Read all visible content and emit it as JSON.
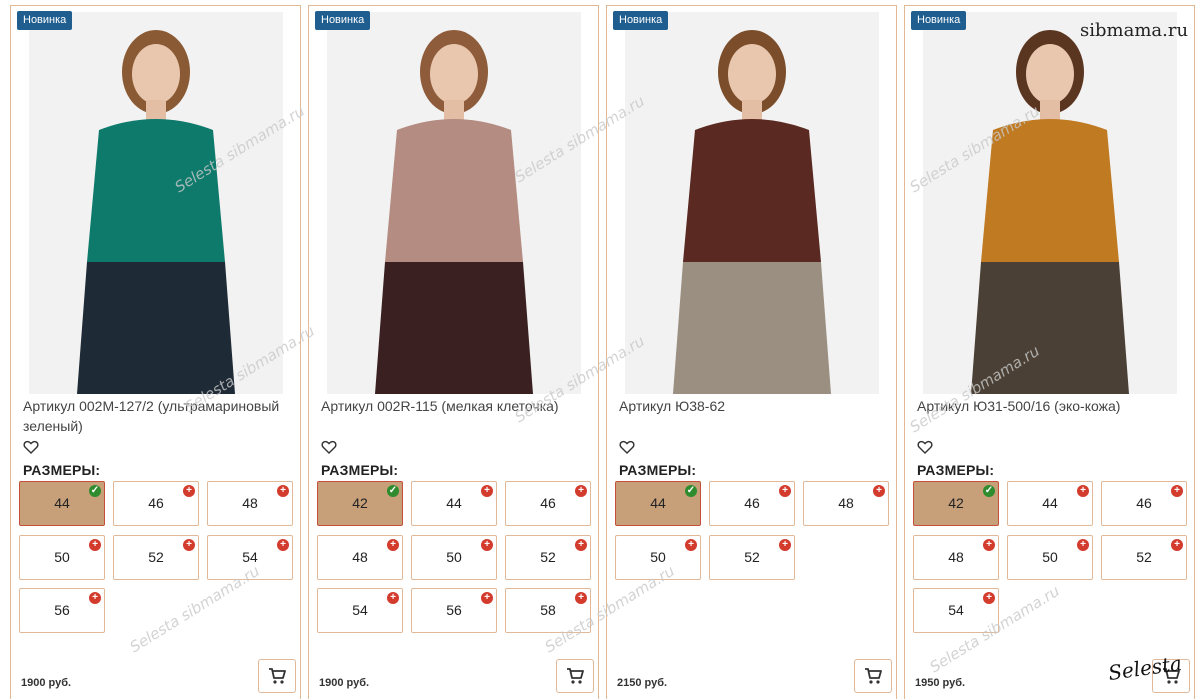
{
  "products": [
    {
      "badge": "Новинка",
      "title": "Артикул 002M-127/2 (ультрамариновый зеленый)",
      "sizes_label": "РАЗМЕРЫ:",
      "price": "1900 руб.",
      "photo": {
        "bg": "#f2f2f2",
        "top": "#0e7a6c",
        "bottom": "#1e2a36",
        "hair": "#8a5a34"
      },
      "sizes": [
        {
          "value": "44",
          "selected": true
        },
        {
          "value": "46",
          "selected": false
        },
        {
          "value": "48",
          "selected": false
        },
        {
          "value": "50",
          "selected": false
        },
        {
          "value": "52",
          "selected": false
        },
        {
          "value": "54",
          "selected": false
        },
        {
          "value": "56",
          "selected": false
        }
      ]
    },
    {
      "badge": "Новинка",
      "title": "Артикул 002R-115 (мелкая клеточка)",
      "sizes_label": "РАЗМЕРЫ:",
      "price": "1900 руб.",
      "photo": {
        "bg": "#f2f2f2",
        "top": "#b48c82",
        "bottom": "#3a2020",
        "hair": "#8e5c3a"
      },
      "sizes": [
        {
          "value": "42",
          "selected": true
        },
        {
          "value": "44",
          "selected": false
        },
        {
          "value": "46",
          "selected": false
        },
        {
          "value": "48",
          "selected": false
        },
        {
          "value": "50",
          "selected": false
        },
        {
          "value": "52",
          "selected": false
        },
        {
          "value": "54",
          "selected": false
        },
        {
          "value": "56",
          "selected": false
        },
        {
          "value": "58",
          "selected": false
        }
      ]
    },
    {
      "badge": "Новинка",
      "title": "Артикул Ю38-62",
      "sizes_label": "РАЗМЕРЫ:",
      "price": "2150 руб.",
      "photo": {
        "bg": "#f2f2f2",
        "top": "#5a2a22",
        "bottom": "#9a8f80",
        "hair": "#7b4d2a"
      },
      "sizes": [
        {
          "value": "44",
          "selected": true
        },
        {
          "value": "46",
          "selected": false
        },
        {
          "value": "48",
          "selected": false
        },
        {
          "value": "50",
          "selected": false
        },
        {
          "value": "52",
          "selected": false
        }
      ]
    },
    {
      "badge": "Новинка",
      "title": "Артикул Ю31-500/16 (эко-кожа)",
      "sizes_label": "РАЗМЕРЫ:",
      "price": "1950 руб.",
      "photo": {
        "bg": "#f2f2f2",
        "top": "#c07a22",
        "bottom": "#4a4035",
        "hair": "#5a3520"
      },
      "sizes": [
        {
          "value": "42",
          "selected": true
        },
        {
          "value": "44",
          "selected": false
        },
        {
          "value": "46",
          "selected": false
        },
        {
          "value": "48",
          "selected": false
        },
        {
          "value": "50",
          "selected": false
        },
        {
          "value": "52",
          "selected": false
        },
        {
          "value": "54",
          "selected": false
        }
      ]
    }
  ],
  "watermark": {
    "site": "sibmama.ru",
    "signature": "Selesta",
    "faint": "Selesta sibmama.ru"
  },
  "icons": {
    "favorite": "heart-outline-icon",
    "cart": "cart-icon",
    "available": "check-circle-icon",
    "unavailable": "plus-circle-icon"
  },
  "colors": {
    "badge": "#1f5e8f",
    "card_border": "#e2b993",
    "selected_size": "#c7a07a",
    "plus": "#d33b2c",
    "check": "#2e8b2e"
  }
}
